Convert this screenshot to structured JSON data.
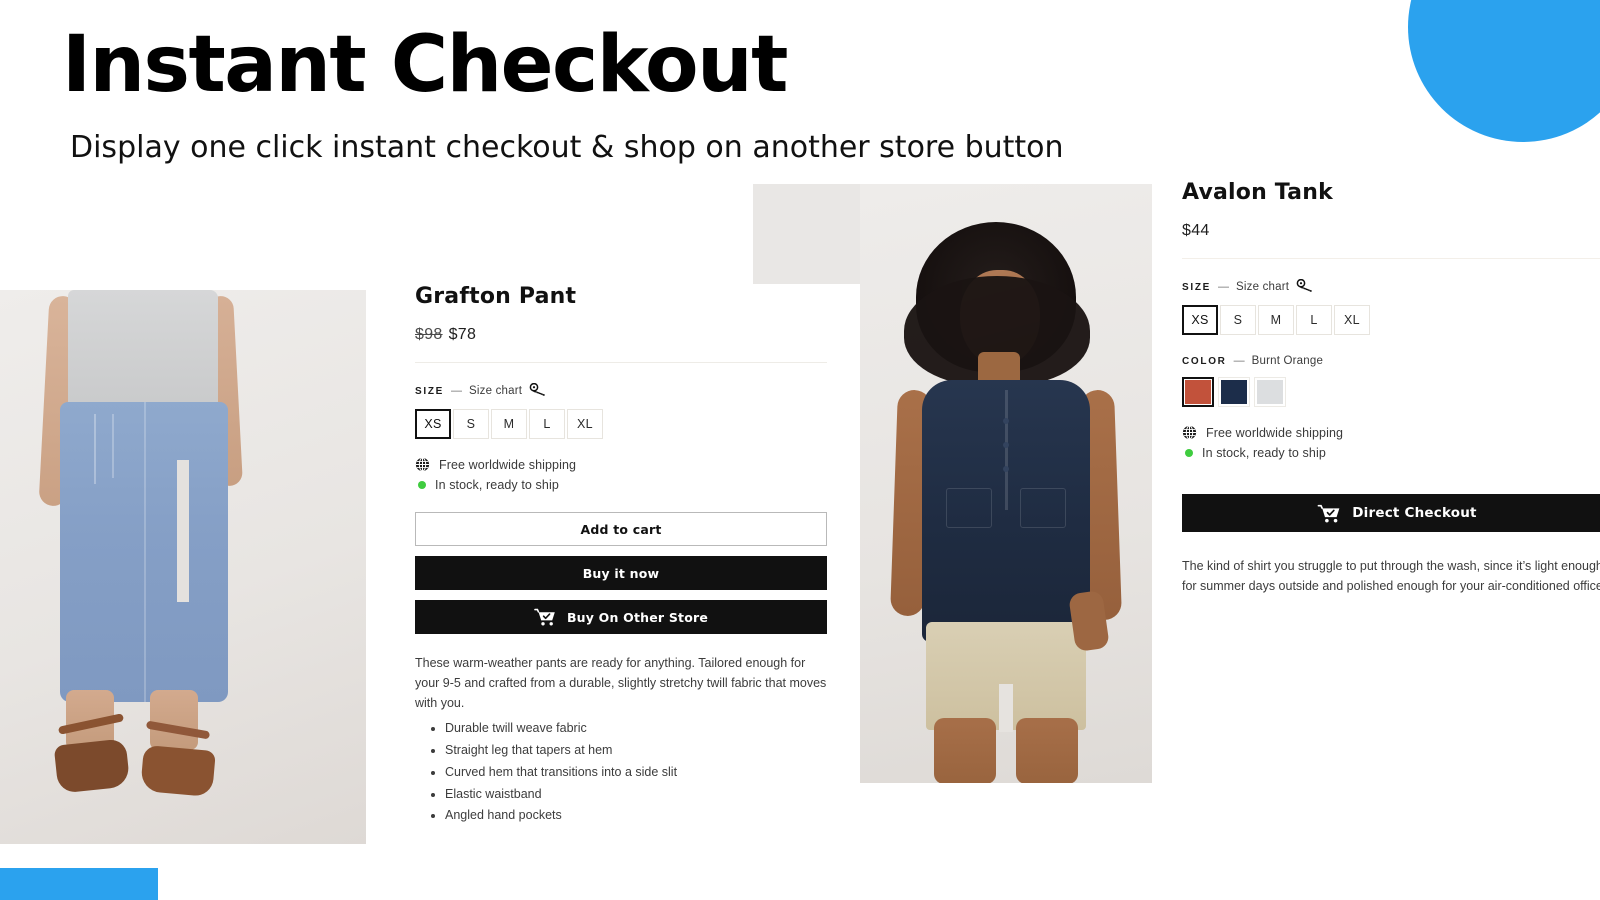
{
  "header": {
    "title": "Instant Checkout",
    "subtitle": "Display one click instant checkout & shop on another store button"
  },
  "decor": {
    "accent_color": "#2BA2EE",
    "circle_name": "blue-circle-decoration",
    "bar_name": "blue-bar-decoration"
  },
  "product_left": {
    "title": "Grafton Pant",
    "price_old": "$98",
    "price_new": "$78",
    "size": {
      "label": "SIZE",
      "dash": "—",
      "chart_link": "Size chart",
      "options": [
        "XS",
        "S",
        "M",
        "L",
        "XL"
      ],
      "selected": "XS"
    },
    "shipping": "Free worldwide shipping",
    "stock": "In stock, ready to ship",
    "buttons": {
      "add_to_cart": "Add to cart",
      "buy_it_now": "Buy it now",
      "buy_other_store": "Buy On Other Store"
    },
    "description": "These warm-weather pants are ready for anything. Tailored enough for your 9-5 and crafted from a durable, slightly stretchy twill fabric that moves with you.",
    "features": [
      "Durable twill weave fabric",
      "Straight leg that tapers at hem",
      "Curved hem that transitions into a side slit",
      "Elastic waistband",
      "Angled hand pockets"
    ]
  },
  "product_right": {
    "title": "Avalon Tank",
    "price": "$44",
    "size": {
      "label": "SIZE",
      "dash": "—",
      "chart_link": "Size chart",
      "options": [
        "XS",
        "S",
        "M",
        "L",
        "XL"
      ],
      "selected": "XS"
    },
    "color": {
      "label": "COLOR",
      "dash": "—",
      "selected_name": "Burnt Orange",
      "swatches": [
        "#C2523B",
        "#1C2D4A",
        "#DCDEE0"
      ]
    },
    "shipping": "Free worldwide shipping",
    "stock": "In stock, ready to ship",
    "buttons": {
      "direct_checkout": "Direct Checkout"
    },
    "description": "The kind of shirt you struggle to put through the wash, since it’s light enough for summer days outside and polished enough for your air-conditioned office."
  }
}
